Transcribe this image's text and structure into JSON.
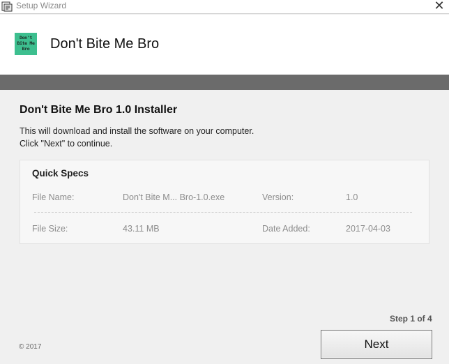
{
  "window": {
    "title": "Setup Wizard",
    "close_glyph": "✕"
  },
  "header": {
    "logo_text": "Don't Bite Me Bro",
    "app_name": "Don't Bite Me Bro"
  },
  "content": {
    "title": "Don't Bite Me Bro 1.0 Installer",
    "line1": "This will download and install the software on your computer.",
    "line2": "Click \"Next\" to continue."
  },
  "specs": {
    "title": "Quick Specs",
    "file_name_label": "File Name:",
    "file_name_value": "Don't Bite M... Bro-1.0.exe",
    "version_label": "Version:",
    "version_value": "1.0",
    "file_size_label": "File Size:",
    "file_size_value": "43.11 MB",
    "date_added_label": "Date Added:",
    "date_added_value": "2017-04-03"
  },
  "footer": {
    "step": "Step 1 of 4",
    "copyright": "© 2017",
    "next_label": "Next"
  },
  "colors": {
    "logo_bg": "#3dbf8f",
    "band": "#6b6b6b"
  }
}
